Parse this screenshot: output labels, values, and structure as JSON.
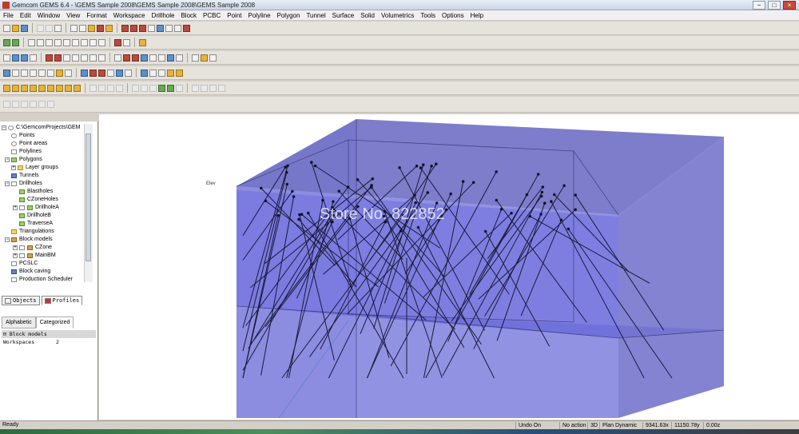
{
  "window": {
    "title": "Gemcom GEMS 6.4 - \\GEMS Sample 2008\\GEMS Sample 2008\\GEMS Sample 2008"
  },
  "menu": [
    "File",
    "Edit",
    "Window",
    "View",
    "Format",
    "Workspace",
    "Drillhole",
    "Block",
    "PCBC",
    "Point",
    "Polyline",
    "Polygon",
    "Tunnel",
    "Surface",
    "Solid",
    "Volumetrics",
    "Tools",
    "Options",
    "Help"
  ],
  "tree": {
    "root": "C:\\GemcomProjects\\GEM",
    "items": [
      "Points",
      "Point areas",
      "Polylines",
      "Polygons",
      "Layer groups",
      "Tunnels",
      "Drillholes",
      "Blastholes",
      "CZoneHoles",
      "DrillholeA",
      "DrillholeB",
      "TraverseA",
      "Triangulations",
      "Block models",
      "CZone",
      "MainBM",
      "PCSLC",
      "Block caving",
      "Production Scheduler"
    ]
  },
  "panel_tabs": [
    "Objects",
    "Profiles"
  ],
  "property_tabs": [
    "Alphabetic",
    "Categorized"
  ],
  "properties": {
    "category": "Block models",
    "rows": [
      {
        "key": "Workspaces",
        "value": "2"
      }
    ]
  },
  "viewport": {
    "axis_label": "Elev",
    "watermark": "Store No. 822852",
    "box_fill": "#5a5ad6",
    "line_color": "#1a1a3a"
  },
  "status": {
    "ready": "Ready",
    "undo": "Undo On",
    "action": "No action",
    "mode_3d": "3D",
    "plan": "Plan Dynamic",
    "x": "9341.63x",
    "y": "11150.78y",
    "z": "0.00z"
  }
}
